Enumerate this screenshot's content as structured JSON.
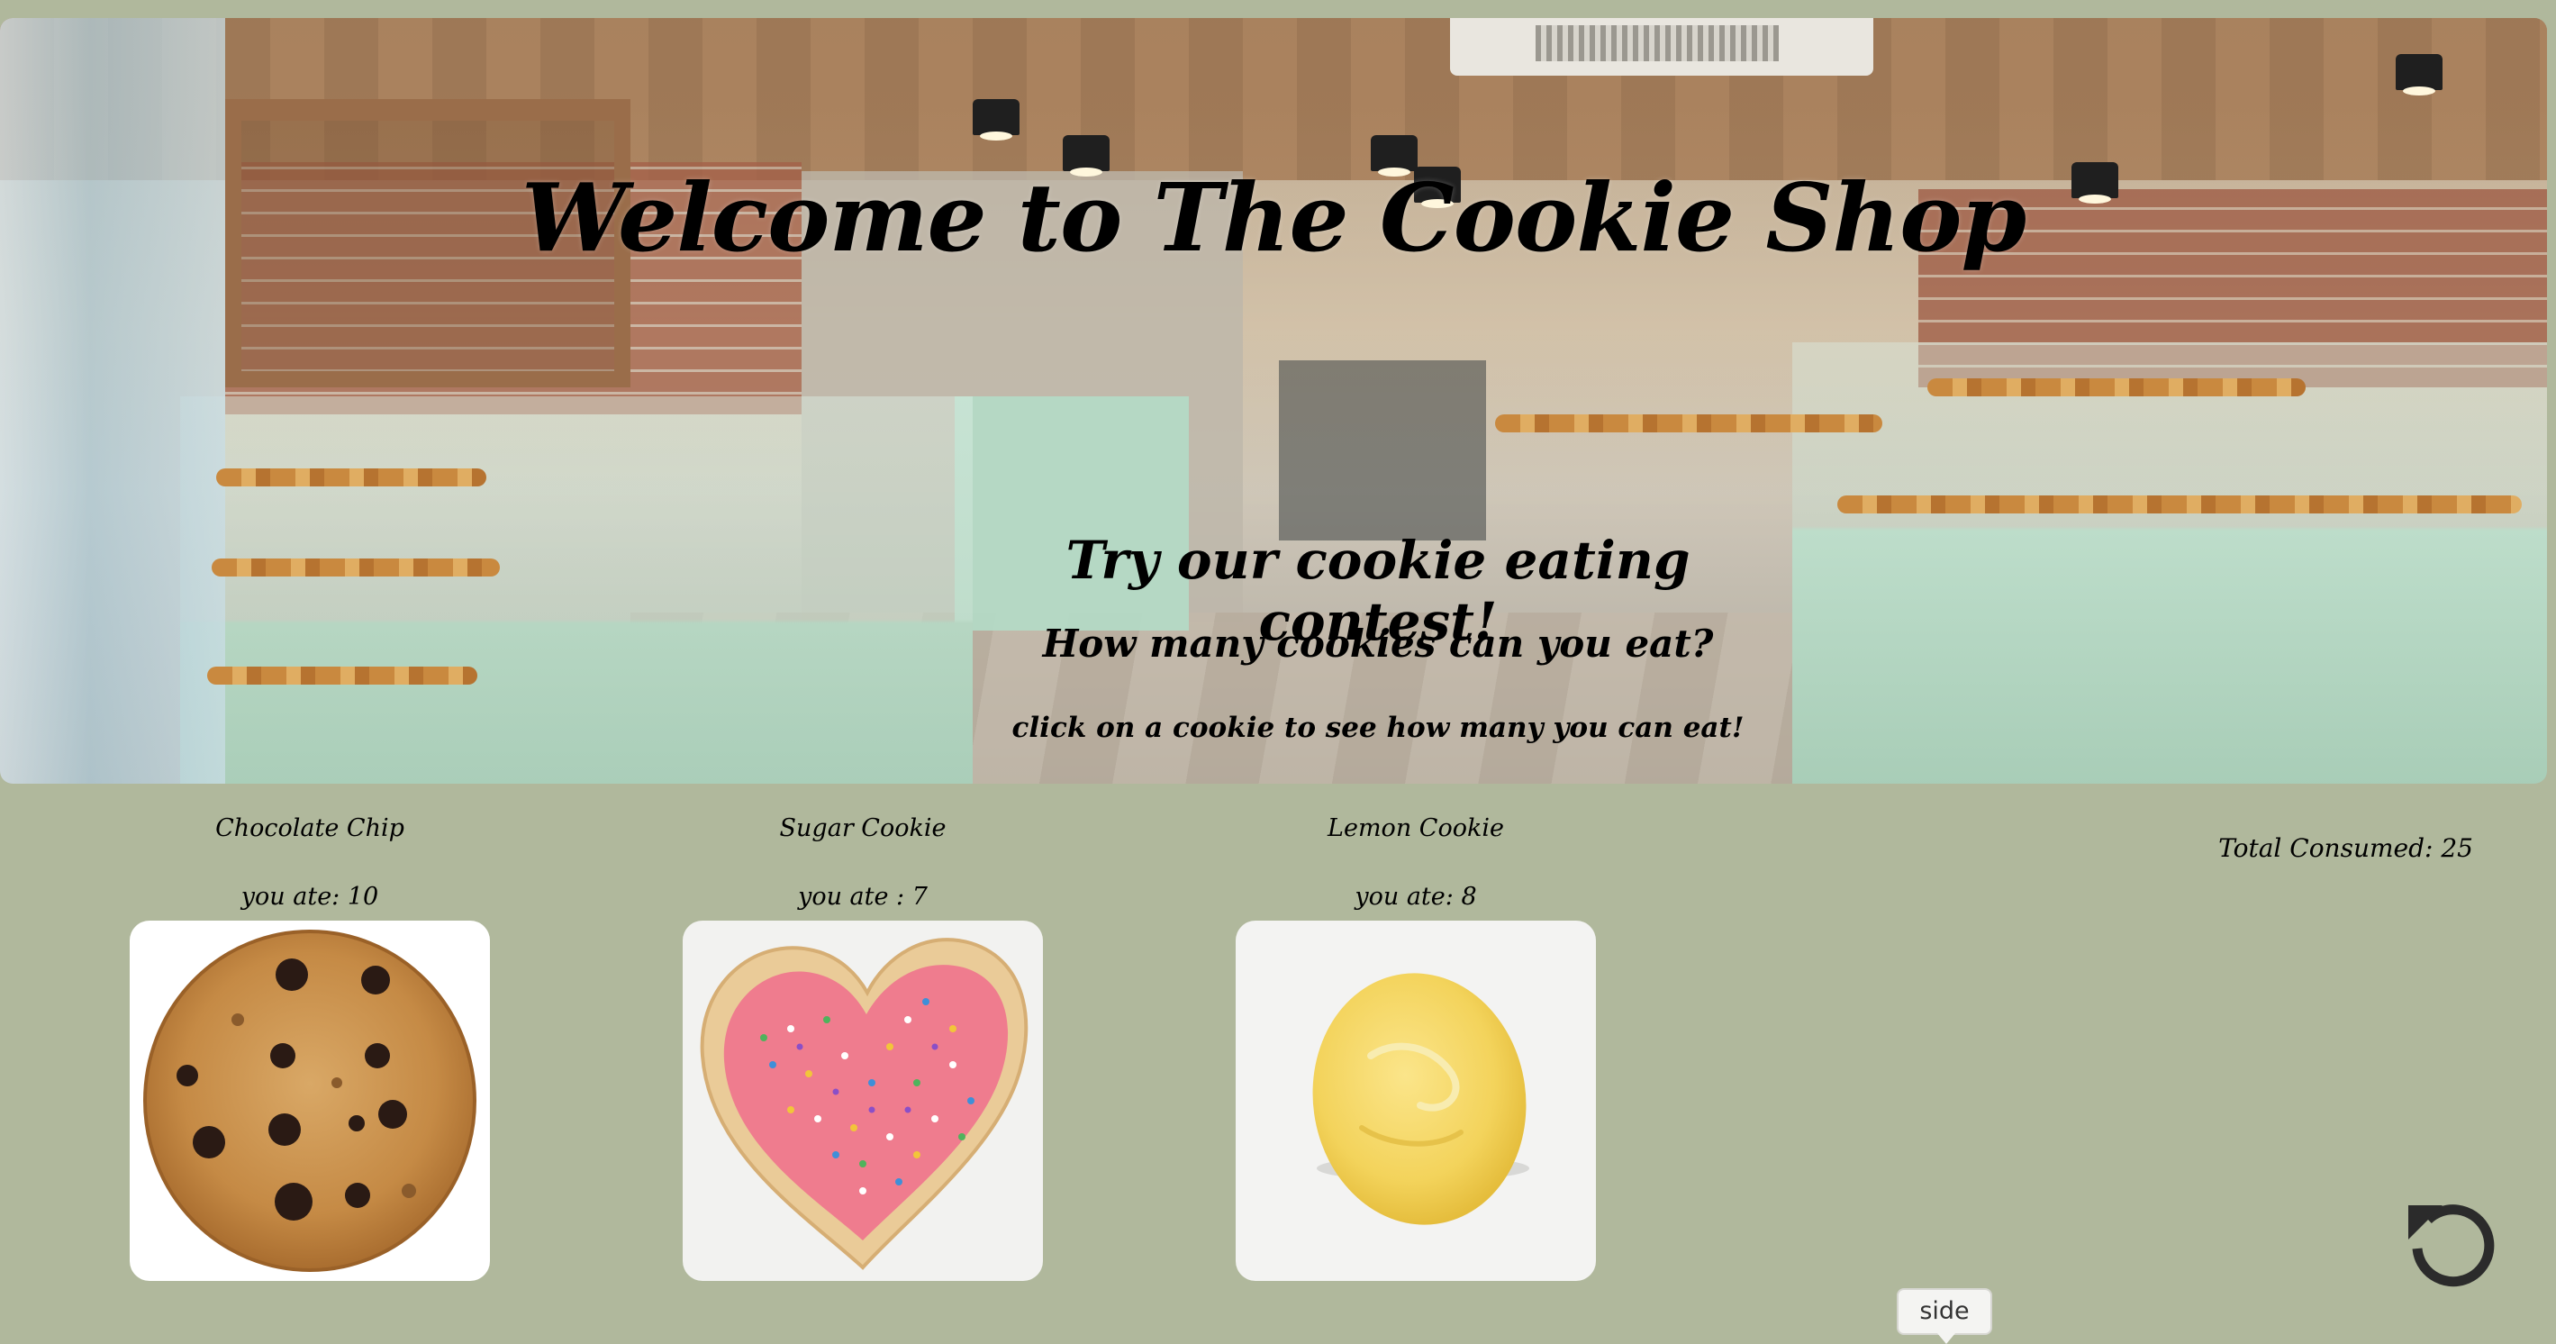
{
  "hero": {
    "title": "Welcome to The Cookie Shop",
    "subtitle": "Try our cookie eating contest!",
    "question": "How many cookies can you eat?",
    "instruction": "click on a cookie to see how many you can eat!"
  },
  "cookies": [
    {
      "name": "Chocolate Chip",
      "count_label": "you ate: 10",
      "icon": "chocolate-chip-cookie-image"
    },
    {
      "name": "Sugar Cookie",
      "count_label": "you ate : 7",
      "icon": "sugar-cookie-image"
    },
    {
      "name": "Lemon Cookie",
      "count_label": "you ate: 8",
      "icon": "lemon-cookie-image"
    }
  ],
  "total_label": "Total Consumed: 25",
  "reset": {
    "icon": "reset-icon"
  },
  "tooltip": {
    "text": "side"
  },
  "colors": {
    "page_background": "#b0b89c",
    "text": "#000000",
    "card_background": "#ffffff"
  }
}
